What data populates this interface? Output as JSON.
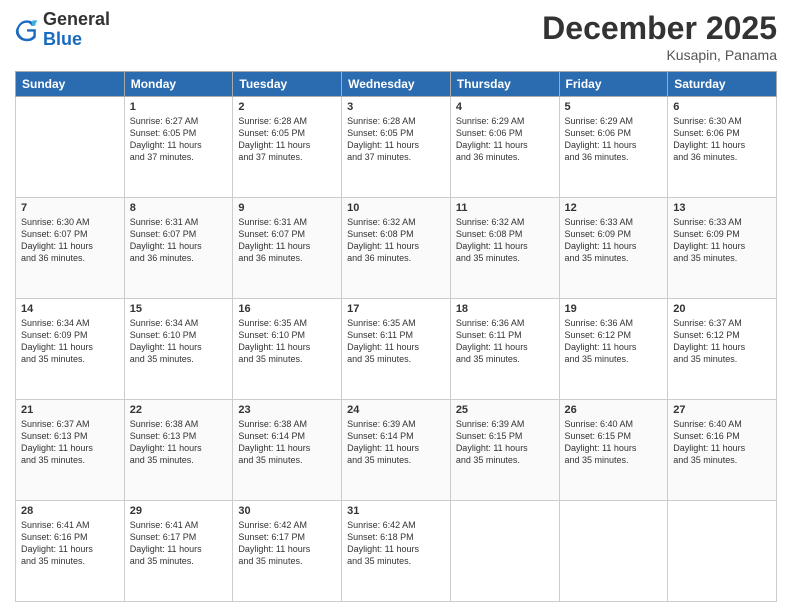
{
  "logo": {
    "general": "General",
    "blue": "Blue"
  },
  "title": "December 2025",
  "subtitle": "Kusapin, Panama",
  "days_of_week": [
    "Sunday",
    "Monday",
    "Tuesday",
    "Wednesday",
    "Thursday",
    "Friday",
    "Saturday"
  ],
  "weeks": [
    [
      {
        "day": "",
        "sunrise": "",
        "sunset": "",
        "daylight": ""
      },
      {
        "day": "1",
        "sunrise": "Sunrise: 6:27 AM",
        "sunset": "Sunset: 6:05 PM",
        "daylight": "Daylight: 11 hours and 37 minutes."
      },
      {
        "day": "2",
        "sunrise": "Sunrise: 6:28 AM",
        "sunset": "Sunset: 6:05 PM",
        "daylight": "Daylight: 11 hours and 37 minutes."
      },
      {
        "day": "3",
        "sunrise": "Sunrise: 6:28 AM",
        "sunset": "Sunset: 6:05 PM",
        "daylight": "Daylight: 11 hours and 37 minutes."
      },
      {
        "day": "4",
        "sunrise": "Sunrise: 6:29 AM",
        "sunset": "Sunset: 6:06 PM",
        "daylight": "Daylight: 11 hours and 36 minutes."
      },
      {
        "day": "5",
        "sunrise": "Sunrise: 6:29 AM",
        "sunset": "Sunset: 6:06 PM",
        "daylight": "Daylight: 11 hours and 36 minutes."
      },
      {
        "day": "6",
        "sunrise": "Sunrise: 6:30 AM",
        "sunset": "Sunset: 6:06 PM",
        "daylight": "Daylight: 11 hours and 36 minutes."
      }
    ],
    [
      {
        "day": "7",
        "sunrise": "Sunrise: 6:30 AM",
        "sunset": "Sunset: 6:07 PM",
        "daylight": "Daylight: 11 hours and 36 minutes."
      },
      {
        "day": "8",
        "sunrise": "Sunrise: 6:31 AM",
        "sunset": "Sunset: 6:07 PM",
        "daylight": "Daylight: 11 hours and 36 minutes."
      },
      {
        "day": "9",
        "sunrise": "Sunrise: 6:31 AM",
        "sunset": "Sunset: 6:07 PM",
        "daylight": "Daylight: 11 hours and 36 minutes."
      },
      {
        "day": "10",
        "sunrise": "Sunrise: 6:32 AM",
        "sunset": "Sunset: 6:08 PM",
        "daylight": "Daylight: 11 hours and 36 minutes."
      },
      {
        "day": "11",
        "sunrise": "Sunrise: 6:32 AM",
        "sunset": "Sunset: 6:08 PM",
        "daylight": "Daylight: 11 hours and 35 minutes."
      },
      {
        "day": "12",
        "sunrise": "Sunrise: 6:33 AM",
        "sunset": "Sunset: 6:09 PM",
        "daylight": "Daylight: 11 hours and 35 minutes."
      },
      {
        "day": "13",
        "sunrise": "Sunrise: 6:33 AM",
        "sunset": "Sunset: 6:09 PM",
        "daylight": "Daylight: 11 hours and 35 minutes."
      }
    ],
    [
      {
        "day": "14",
        "sunrise": "Sunrise: 6:34 AM",
        "sunset": "Sunset: 6:09 PM",
        "daylight": "Daylight: 11 hours and 35 minutes."
      },
      {
        "day": "15",
        "sunrise": "Sunrise: 6:34 AM",
        "sunset": "Sunset: 6:10 PM",
        "daylight": "Daylight: 11 hours and 35 minutes."
      },
      {
        "day": "16",
        "sunrise": "Sunrise: 6:35 AM",
        "sunset": "Sunset: 6:10 PM",
        "daylight": "Daylight: 11 hours and 35 minutes."
      },
      {
        "day": "17",
        "sunrise": "Sunrise: 6:35 AM",
        "sunset": "Sunset: 6:11 PM",
        "daylight": "Daylight: 11 hours and 35 minutes."
      },
      {
        "day": "18",
        "sunrise": "Sunrise: 6:36 AM",
        "sunset": "Sunset: 6:11 PM",
        "daylight": "Daylight: 11 hours and 35 minutes."
      },
      {
        "day": "19",
        "sunrise": "Sunrise: 6:36 AM",
        "sunset": "Sunset: 6:12 PM",
        "daylight": "Daylight: 11 hours and 35 minutes."
      },
      {
        "day": "20",
        "sunrise": "Sunrise: 6:37 AM",
        "sunset": "Sunset: 6:12 PM",
        "daylight": "Daylight: 11 hours and 35 minutes."
      }
    ],
    [
      {
        "day": "21",
        "sunrise": "Sunrise: 6:37 AM",
        "sunset": "Sunset: 6:13 PM",
        "daylight": "Daylight: 11 hours and 35 minutes."
      },
      {
        "day": "22",
        "sunrise": "Sunrise: 6:38 AM",
        "sunset": "Sunset: 6:13 PM",
        "daylight": "Daylight: 11 hours and 35 minutes."
      },
      {
        "day": "23",
        "sunrise": "Sunrise: 6:38 AM",
        "sunset": "Sunset: 6:14 PM",
        "daylight": "Daylight: 11 hours and 35 minutes."
      },
      {
        "day": "24",
        "sunrise": "Sunrise: 6:39 AM",
        "sunset": "Sunset: 6:14 PM",
        "daylight": "Daylight: 11 hours and 35 minutes."
      },
      {
        "day": "25",
        "sunrise": "Sunrise: 6:39 AM",
        "sunset": "Sunset: 6:15 PM",
        "daylight": "Daylight: 11 hours and 35 minutes."
      },
      {
        "day": "26",
        "sunrise": "Sunrise: 6:40 AM",
        "sunset": "Sunset: 6:15 PM",
        "daylight": "Daylight: 11 hours and 35 minutes."
      },
      {
        "day": "27",
        "sunrise": "Sunrise: 6:40 AM",
        "sunset": "Sunset: 6:16 PM",
        "daylight": "Daylight: 11 hours and 35 minutes."
      }
    ],
    [
      {
        "day": "28",
        "sunrise": "Sunrise: 6:41 AM",
        "sunset": "Sunset: 6:16 PM",
        "daylight": "Daylight: 11 hours and 35 minutes."
      },
      {
        "day": "29",
        "sunrise": "Sunrise: 6:41 AM",
        "sunset": "Sunset: 6:17 PM",
        "daylight": "Daylight: 11 hours and 35 minutes."
      },
      {
        "day": "30",
        "sunrise": "Sunrise: 6:42 AM",
        "sunset": "Sunset: 6:17 PM",
        "daylight": "Daylight: 11 hours and 35 minutes."
      },
      {
        "day": "31",
        "sunrise": "Sunrise: 6:42 AM",
        "sunset": "Sunset: 6:18 PM",
        "daylight": "Daylight: 11 hours and 35 minutes."
      },
      {
        "day": "",
        "sunrise": "",
        "sunset": "",
        "daylight": ""
      },
      {
        "day": "",
        "sunrise": "",
        "sunset": "",
        "daylight": ""
      },
      {
        "day": "",
        "sunrise": "",
        "sunset": "",
        "daylight": ""
      }
    ]
  ]
}
